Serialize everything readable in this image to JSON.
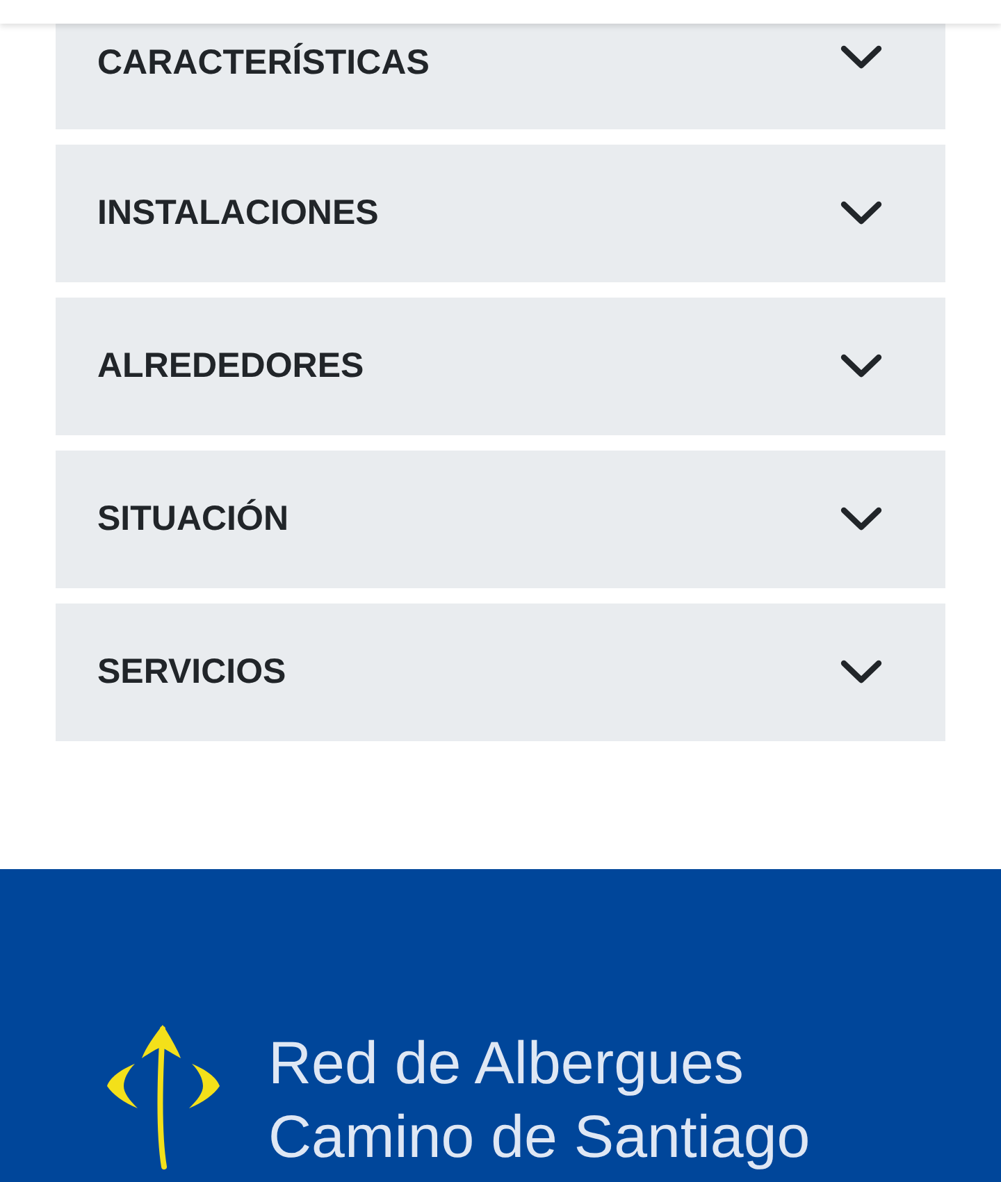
{
  "accordion": {
    "items": [
      {
        "title": "CARACTERÍSTICAS",
        "expanded": false
      },
      {
        "title": "INSTALACIONES",
        "expanded": false
      },
      {
        "title": "ALREDEDORES",
        "expanded": false
      },
      {
        "title": "SITUACIÓN",
        "expanded": false
      },
      {
        "title": "SERVICIOS",
        "expanded": false
      }
    ]
  },
  "footer": {
    "brand": {
      "lines": [
        "Red de Albergues",
        "Camino de Santiago"
      ]
    }
  }
}
